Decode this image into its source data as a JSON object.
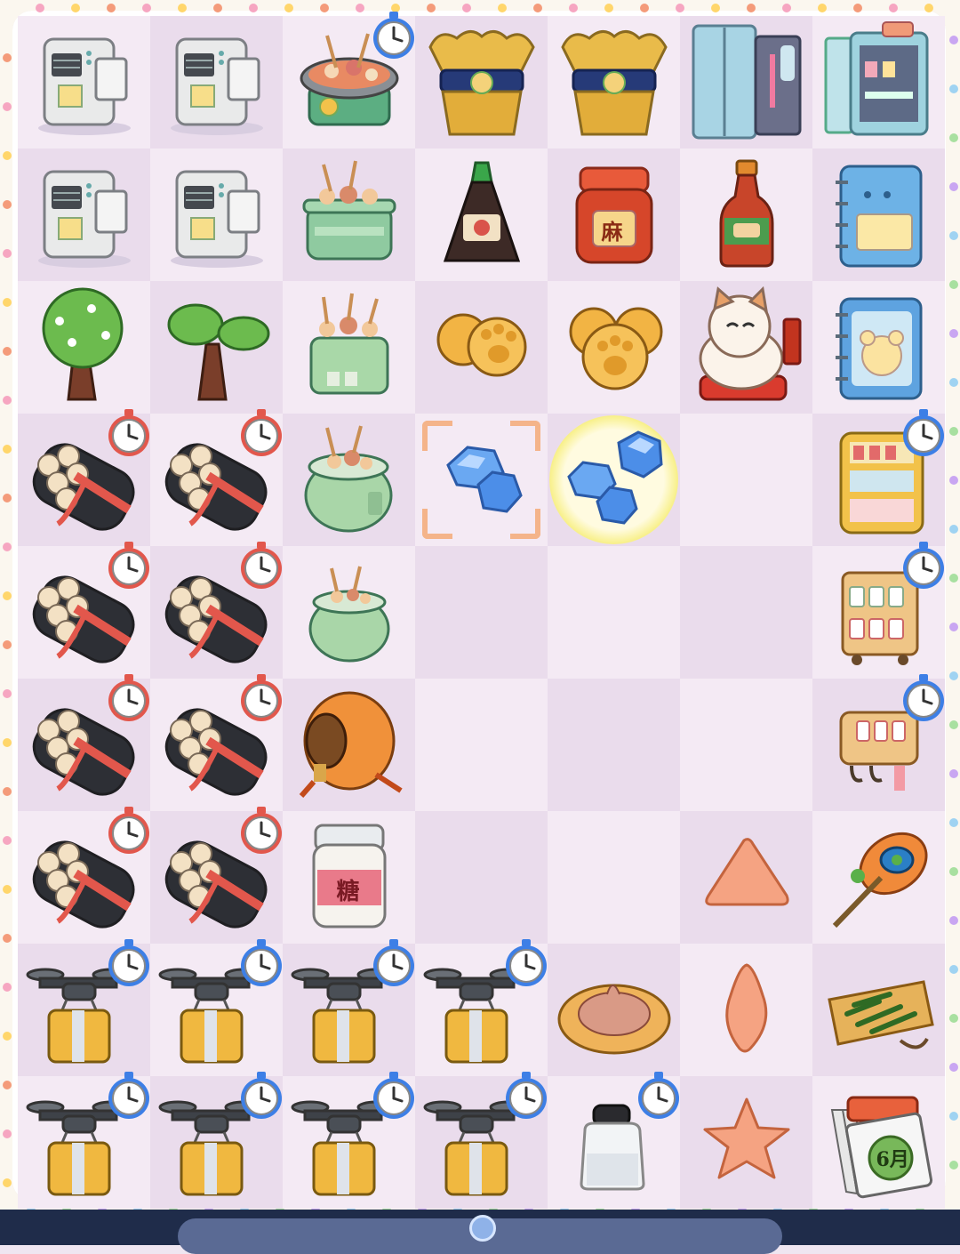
{
  "board": {
    "rows": 9,
    "cols": 7,
    "selected_cell": "3-3",
    "highlight_cell": "3-4",
    "cells": [
      [
        {
          "item": "receipt-printer-icon",
          "timer": false
        },
        {
          "item": "receipt-printer-icon",
          "timer": false
        },
        {
          "item": "skewer-hotpot-pot-icon",
          "timer": true,
          "timer_color": "blue"
        },
        {
          "item": "golden-pouch-icon",
          "timer": false
        },
        {
          "item": "golden-pouch-icon",
          "timer": false
        },
        {
          "item": "blue-locker-icon",
          "timer": false
        },
        {
          "item": "open-fridge-icon",
          "timer": false
        }
      ],
      [
        {
          "item": "receipt-printer-icon",
          "timer": false
        },
        {
          "item": "receipt-printer-icon",
          "timer": false
        },
        {
          "item": "skewer-steamer-icon",
          "timer": false
        },
        {
          "item": "soy-sauce-bottle-icon",
          "timer": false
        },
        {
          "item": "chili-jar-icon",
          "timer": false,
          "label": "麻"
        },
        {
          "item": "sauce-bottle-icon",
          "timer": false
        },
        {
          "item": "blue-notebook-icon",
          "timer": false
        }
      ],
      [
        {
          "item": "flowering-tree-icon",
          "timer": false
        },
        {
          "item": "small-tree-icon",
          "timer": false
        },
        {
          "item": "skewer-box-icon",
          "timer": false
        },
        {
          "item": "paw-cookies-small-icon",
          "timer": false
        },
        {
          "item": "paw-cookies-large-icon",
          "timer": false
        },
        {
          "item": "lucky-cat-icon",
          "timer": false
        },
        {
          "item": "bear-notebook-icon",
          "timer": false
        }
      ],
      [
        {
          "item": "firecracker-bundle-icon",
          "timer": true,
          "timer_color": "red"
        },
        {
          "item": "firecracker-bundle-icon",
          "timer": true,
          "timer_color": "red"
        },
        {
          "item": "skewer-rice-cooker-icon",
          "timer": false
        },
        {
          "item": "blue-gems-small-icon",
          "timer": false
        },
        {
          "item": "blue-gems-large-icon",
          "timer": false
        },
        {
          "item": "",
          "timer": false
        },
        {
          "item": "vending-machine-icon",
          "timer": true,
          "timer_color": "blue"
        }
      ],
      [
        {
          "item": "firecracker-bundle-icon",
          "timer": true,
          "timer_color": "red"
        },
        {
          "item": "firecracker-bundle-icon",
          "timer": true,
          "timer_color": "red"
        },
        {
          "item": "small-rice-cooker-icon",
          "timer": false
        },
        {
          "item": "",
          "timer": false
        },
        {
          "item": "",
          "timer": false
        },
        {
          "item": "",
          "timer": false
        },
        {
          "item": "jar-shelf-cart-icon",
          "timer": true,
          "timer_color": "blue"
        }
      ],
      [
        {
          "item": "firecracker-bundle-icon",
          "timer": true,
          "timer_color": "red"
        },
        {
          "item": "firecracker-bundle-icon",
          "timer": true,
          "timer_color": "red"
        },
        {
          "item": "orange-barrel-icon",
          "timer": false
        },
        {
          "item": "",
          "timer": false
        },
        {
          "item": "",
          "timer": false
        },
        {
          "item": "",
          "timer": false
        },
        {
          "item": "wall-shelf-icon",
          "timer": true,
          "timer_color": "blue"
        }
      ],
      [
        {
          "item": "firecracker-bundle-icon",
          "timer": true,
          "timer_color": "red"
        },
        {
          "item": "firecracker-bundle-icon",
          "timer": true,
          "timer_color": "red"
        },
        {
          "item": "sugar-jar-icon",
          "timer": false,
          "label": "糖"
        },
        {
          "item": "",
          "timer": false
        },
        {
          "item": "",
          "timer": false
        },
        {
          "item": "cookie-triangle-icon",
          "timer": false
        },
        {
          "item": "peacock-feather-icon",
          "timer": false
        }
      ],
      [
        {
          "item": "drone-box-icon",
          "timer": true,
          "timer_color": "blue"
        },
        {
          "item": "drone-box-icon",
          "timer": true,
          "timer_color": "blue"
        },
        {
          "item": "drone-box-icon",
          "timer": true,
          "timer_color": "blue"
        },
        {
          "item": "drone-box-icon",
          "timer": true,
          "timer_color": "blue"
        },
        {
          "item": "meat-floss-plate-icon",
          "timer": false
        },
        {
          "item": "cookie-diamond-icon",
          "timer": false
        },
        {
          "item": "green-beans-tray-icon",
          "timer": false
        }
      ],
      [
        {
          "item": "drone-box-icon",
          "timer": true,
          "timer_color": "blue"
        },
        {
          "item": "drone-box-icon",
          "timer": true,
          "timer_color": "blue"
        },
        {
          "item": "drone-box-icon",
          "timer": true,
          "timer_color": "blue"
        },
        {
          "item": "drone-box-icon",
          "timer": true,
          "timer_color": "blue"
        },
        {
          "item": "ink-bottle-icon",
          "timer": true,
          "timer_color": "blue"
        },
        {
          "item": "cookie-star-icon",
          "timer": false
        },
        {
          "item": "calendar-icon",
          "timer": false,
          "label": "6月"
        }
      ]
    ]
  }
}
